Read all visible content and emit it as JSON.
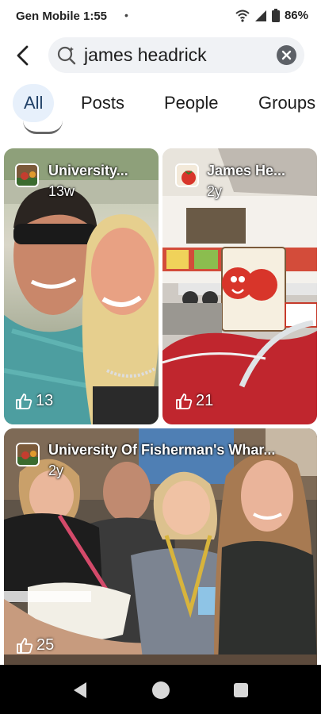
{
  "status": {
    "carrier_time": "Gen Mobile 1:55",
    "dot": "•",
    "battery": "86%"
  },
  "search": {
    "query": "james headrick"
  },
  "tabs": [
    {
      "label": "All",
      "active": true
    },
    {
      "label": "Posts"
    },
    {
      "label": "People"
    },
    {
      "label": "Groups"
    }
  ],
  "results": [
    {
      "author": "University...",
      "time": "13w",
      "likes": "13"
    },
    {
      "author": "James He...",
      "time": "2y",
      "likes": "21"
    },
    {
      "author": "University Of Fisherman's Whar...",
      "time": "2y",
      "likes": "25"
    }
  ],
  "icons": {
    "back": "back-arrow-icon",
    "search": "search-icon",
    "clear": "clear-icon",
    "like": "thumbs-up-icon",
    "nav_back": "nav-back-icon",
    "nav_home": "nav-home-icon",
    "nav_recents": "nav-recents-icon"
  },
  "colors": {
    "active_tab_bg": "#e7f0fb",
    "search_bg": "#f0f2f5",
    "nav_bar": "#000000"
  }
}
